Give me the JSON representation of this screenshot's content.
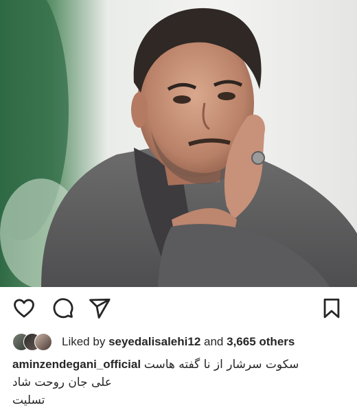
{
  "post": {
    "image_icon": "portrait-photo",
    "actions": {
      "like_icon": "heart-icon",
      "comment_icon": "comment-icon",
      "share_icon": "send-icon",
      "save_icon": "bookmark-icon"
    },
    "likes": {
      "prefix": "Liked by",
      "user": "seyedalisalehi12",
      "conjunction": "and",
      "count": "3,665 others"
    },
    "caption": {
      "username": "aminzendegani_official",
      "line1": "سکوت سرشار از نا گفته هاست",
      "line2": "علی جان روحت شاد",
      "line3": "تسلیت"
    }
  }
}
